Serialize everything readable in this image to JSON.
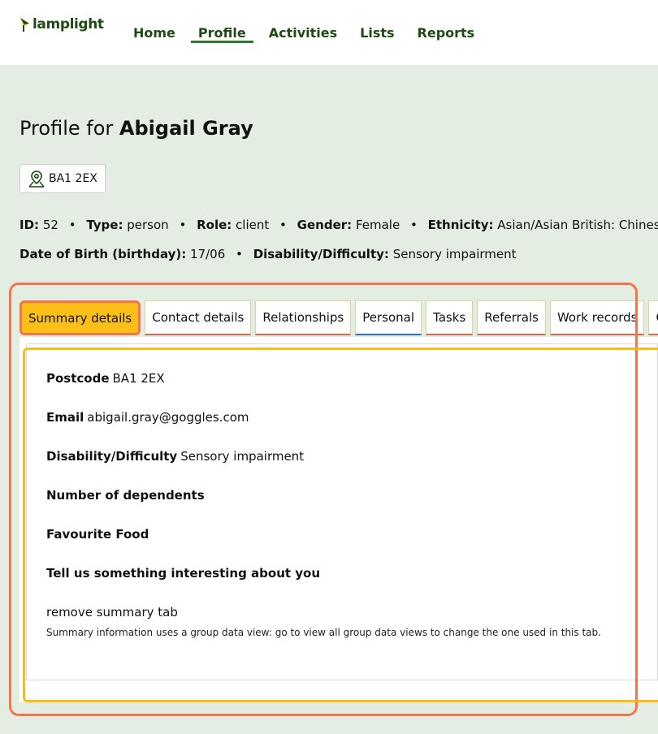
{
  "brand": {
    "name": "lamplight"
  },
  "nav": {
    "items": [
      {
        "label": "Home",
        "active": false
      },
      {
        "label": "Profile",
        "active": true
      },
      {
        "label": "Activities",
        "active": false
      },
      {
        "label": "Lists",
        "active": false
      },
      {
        "label": "Reports",
        "active": false
      }
    ]
  },
  "profile": {
    "title_prefix": "Profile for",
    "name": "Abigail Gray",
    "postcode": "BA1 2EX",
    "meta_row1": [
      {
        "label": "ID:",
        "value": "52"
      },
      {
        "label": "Type:",
        "value": "person"
      },
      {
        "label": "Role:",
        "value": "client"
      },
      {
        "label": "Gender:",
        "value": "Female"
      },
      {
        "label": "Ethnicity:",
        "value": "Asian/Asian British: Chinese"
      }
    ],
    "meta_row2": [
      {
        "label": "Date of Birth (birthday):",
        "value": "17/06"
      },
      {
        "label": "Disability/Difficulty:",
        "value": "Sensory impairment"
      }
    ]
  },
  "tabs": [
    {
      "label": "Summary details",
      "active": true
    },
    {
      "label": "Contact details"
    },
    {
      "label": "Relationships"
    },
    {
      "label": "Personal"
    },
    {
      "label": "Tasks"
    },
    {
      "label": "Referrals"
    },
    {
      "label": "Work records"
    },
    {
      "label": "C"
    }
  ],
  "summary": {
    "fields": [
      {
        "label": "Postcode",
        "value": "BA1 2EX"
      },
      {
        "label": "Email",
        "value": "abigail.gray@goggles.com"
      },
      {
        "label": "Disability/Difficulty",
        "value": "Sensory impairment"
      },
      {
        "label": "Number of dependents",
        "value": ""
      },
      {
        "label": "Favourite Food",
        "value": ""
      },
      {
        "label": "Tell us something interesting about you",
        "value": ""
      }
    ],
    "remove_link": "remove summary tab",
    "note": "Summary information uses a group data view: go to view all group data views to change the one used in this tab."
  },
  "colors": {
    "brand_green": "#1f4a14",
    "page_bg": "#e4ede2",
    "active_tab": "#fbbf17",
    "highlight_red": "#f2754d",
    "highlight_yellow": "#f7bd1f"
  }
}
